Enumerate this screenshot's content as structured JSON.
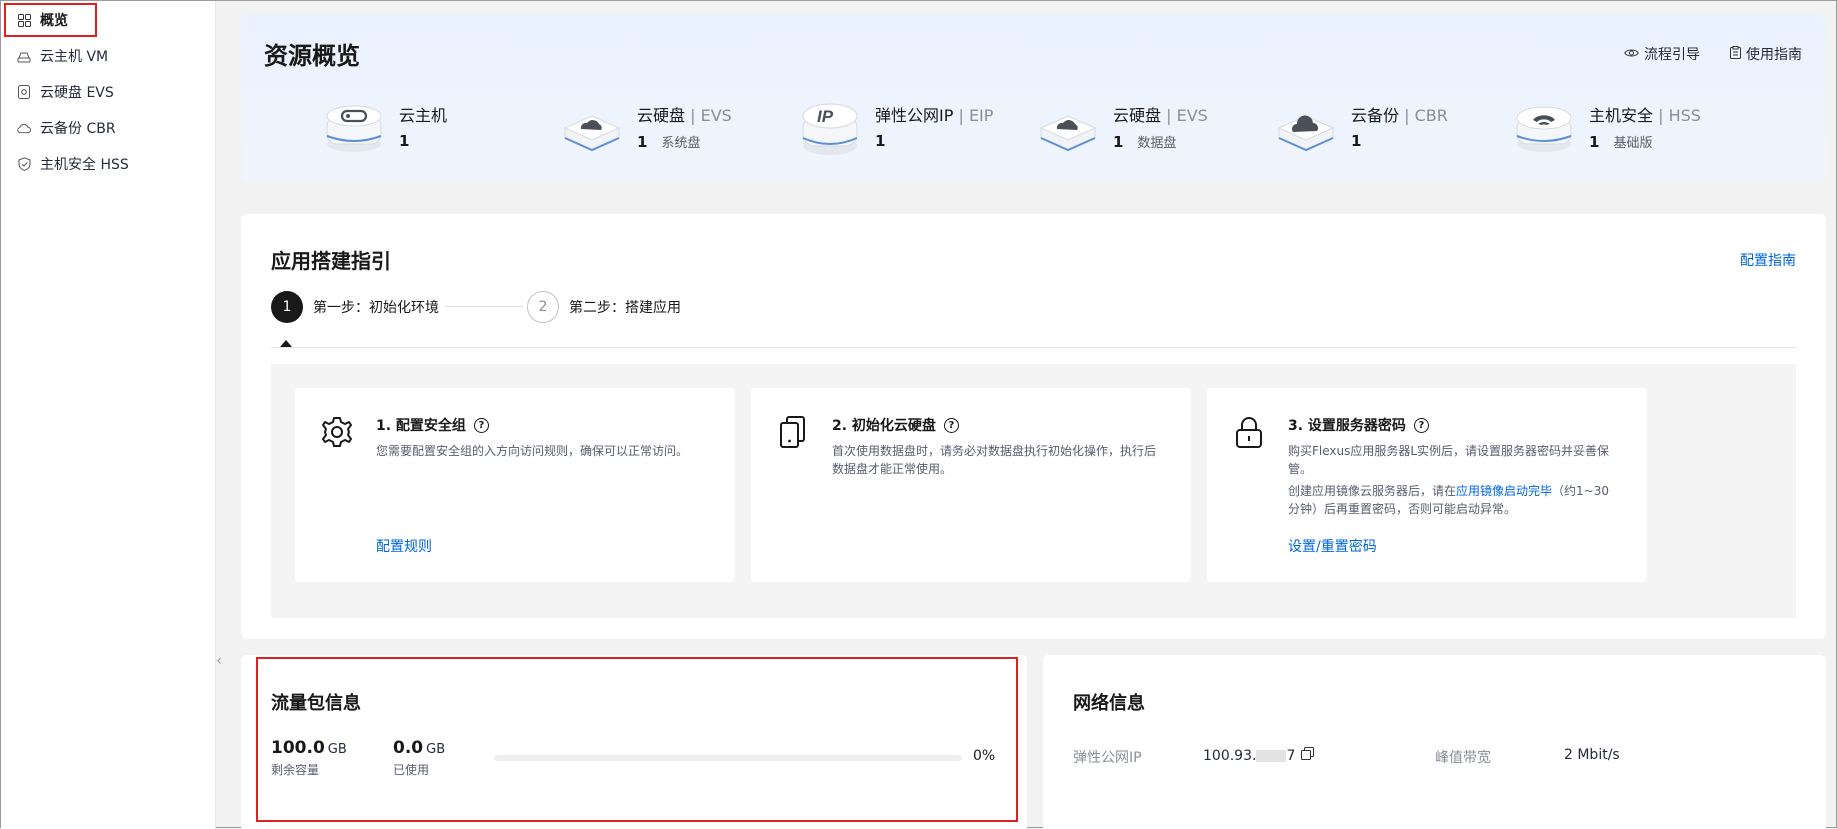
{
  "sidebar": {
    "items": [
      {
        "label": "概览",
        "icon": "grid-icon",
        "active": true
      },
      {
        "label": "云主机 VM",
        "icon": "cloud-host-icon"
      },
      {
        "label": "云硬盘 EVS",
        "icon": "disk-icon"
      },
      {
        "label": "云备份 CBR",
        "icon": "cloud-icon"
      },
      {
        "label": "主机安全 HSS",
        "icon": "shield-check-icon"
      }
    ]
  },
  "overview": {
    "title": "资源概览",
    "links": {
      "flow": "流程引导",
      "guide": "使用指南"
    },
    "resources": [
      {
        "name": "云主机",
        "suffix": "",
        "count": "1",
        "sub": "",
        "icon": "vm-icon"
      },
      {
        "name": "云硬盘",
        "suffix": "EVS",
        "count": "1",
        "sub": "系统盘",
        "icon": "evs-disk-icon"
      },
      {
        "name": "弹性公网IP",
        "suffix": "EIP",
        "count": "1",
        "sub": "",
        "icon": "eip-icon"
      },
      {
        "name": "云硬盘",
        "suffix": "EVS",
        "count": "1",
        "sub": "数据盘",
        "icon": "evs-disk-icon"
      },
      {
        "name": "云备份",
        "suffix": "CBR",
        "count": "1",
        "sub": "",
        "icon": "cbr-cloud-icon"
      },
      {
        "name": "主机安全",
        "suffix": "HSS",
        "count": "1",
        "sub": "基础版",
        "icon": "hss-shield-icon"
      }
    ],
    "separator": " | "
  },
  "guide": {
    "title": "应用搭建指引",
    "config_link": "配置指南",
    "steps": [
      {
        "num": "1",
        "label": "第一步：初始化环境"
      },
      {
        "num": "2",
        "label": "第二步：搭建应用"
      }
    ],
    "cards": [
      {
        "title": "1. 配置安全组",
        "desc": "您需要配置安全组的入方向访问规则，确保可以正常访问。",
        "link": "配置规则",
        "icon": "gear-icon"
      },
      {
        "title": "2. 初始化云硬盘",
        "desc": "首次使用数据盘时，请务必对数据盘执行初始化操作，执行后数据盘才能正常使用。",
        "link": "",
        "icon": "disk-stack-icon"
      },
      {
        "title": "3. 设置服务器密码",
        "desc": "购买Flexus应用服务器L实例后，请设置服务器密码并妥善保管。",
        "desc2a": "创建应用镜像云服务器后，请在",
        "desc2link": "应用镜像启动完毕",
        "desc2b": "（约1~30分钟）后再重置密码，否则可能启动异常。",
        "link": "设置/重置密码",
        "icon": "lock-icon"
      }
    ],
    "help_glyph": "?"
  },
  "traffic": {
    "title": "流量包信息",
    "remaining_value": "100.0",
    "remaining_unit": "GB",
    "remaining_label": "剩余容量",
    "used_value": "0.0",
    "used_unit": "GB",
    "used_label": "已使用",
    "percent": "0%",
    "used_fraction": 0
  },
  "network": {
    "title": "网络信息",
    "eip_label": "弹性公网IP",
    "eip_value_a": "100.93.",
    "eip_value_b": "7",
    "bandwidth_label": "峰值带宽",
    "bandwidth_value": "2 Mbit/s"
  },
  "colors": {
    "accent": "#0066e0",
    "highlight": "#e02020"
  }
}
